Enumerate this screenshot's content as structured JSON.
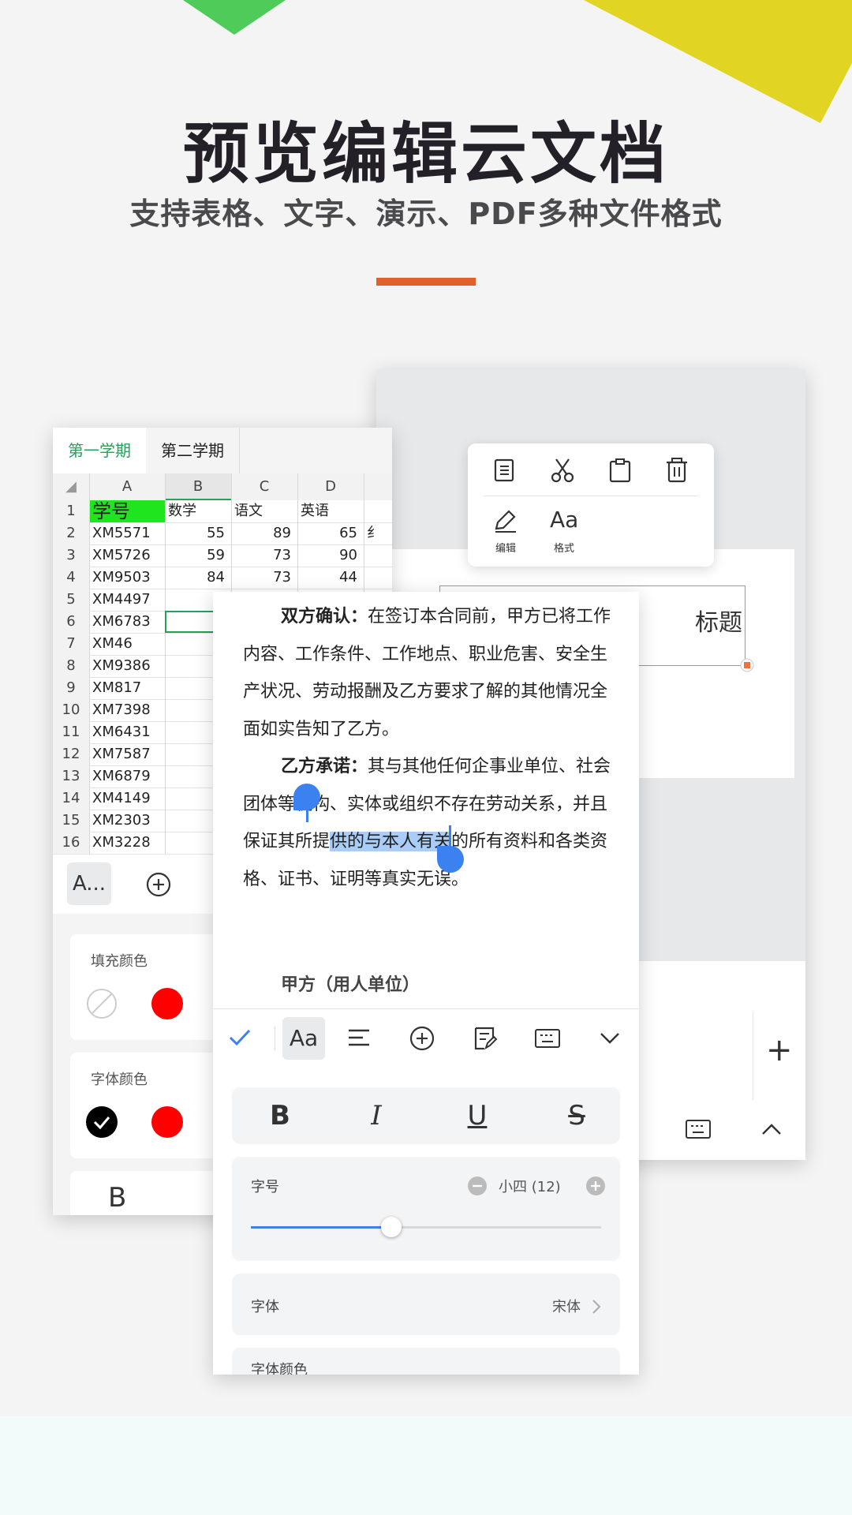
{
  "header": {
    "title": "预览编辑云文档",
    "subtitle": "支持表格、文字、演示、PDF多种文件格式"
  },
  "colors": {
    "accent_bar": "#e0612a",
    "deco_green": "#4fcb5a",
    "deco_yellow": "#e2d422",
    "selection": "#a9cdf6",
    "handle": "#3b82f0",
    "tab_active": "#23a35a"
  },
  "spreadsheet": {
    "tabs": [
      "第一学期",
      "第二学期"
    ],
    "columns": [
      "A",
      "B",
      "C",
      "D"
    ],
    "header_row": [
      "学号",
      "数学",
      "语文",
      "英语"
    ],
    "rows": [
      {
        "n": "1"
      },
      {
        "n": "2",
        "a": "XM5571",
        "b": "55",
        "c": "89",
        "d": "65",
        "e": "纟"
      },
      {
        "n": "3",
        "a": "XM5726",
        "b": "59",
        "c": "73",
        "d": "90"
      },
      {
        "n": "4",
        "a": "XM9503",
        "b": "84",
        "c": "73",
        "d": "44"
      },
      {
        "n": "5",
        "a": "XM4497"
      },
      {
        "n": "6",
        "a": "XM6783"
      },
      {
        "n": "7",
        "a": "XM46"
      },
      {
        "n": "8",
        "a": "XM9386"
      },
      {
        "n": "9",
        "a": "XM817"
      },
      {
        "n": "10",
        "a": "XM7398"
      },
      {
        "n": "11",
        "a": "XM6431"
      },
      {
        "n": "12",
        "a": "XM7587"
      },
      {
        "n": "13",
        "a": "XM6879"
      },
      {
        "n": "14",
        "a": "XM4149"
      },
      {
        "n": "15",
        "a": "XM2303"
      },
      {
        "n": "16",
        "a": "XM3228"
      }
    ],
    "toolbar": {
      "text_style_icon": "A..."
    },
    "fill_color_label": "填充颜色",
    "font_color_label": "字体颜色",
    "bold_label": "B"
  },
  "presentation": {
    "context_menu": {
      "icons": [
        "copy-icon",
        "cut-icon",
        "paste-icon",
        "delete-icon"
      ],
      "edit_label": "编辑",
      "format_label": "格式",
      "format_glyph": "Aa"
    },
    "title_placeholder": "标题",
    "add_label": "+"
  },
  "document": {
    "para1_bold": "双方确认：",
    "para1_text": "在签订本合同前，甲方已将工作内容、工作条件、工作地点、职业危害、安全生产状况、劳动报酬及乙方要求了解的其他情况全面如实告知了乙方。",
    "para2_bold": "乙方承诺：",
    "para2_pre": "其与其他任何企事业单位、社会团体等机构、实体或组织不存在劳动关系，并且保证其所提",
    "para2_sel": "供的与本人有关",
    "para2_post": "的所有资料和各类资格、证书、证明等真实无误。",
    "party_a": "甲方（用人单位）",
    "toolbar_font_glyph": "Aa",
    "format_buttons": [
      "B",
      "I",
      "U",
      "S"
    ],
    "font_size_label": "字号",
    "font_size_value": "小四 (12)",
    "font_size_level": 0.4,
    "font_label": "字体",
    "font_value": "宋体",
    "font_color_label": "字体颜色"
  }
}
